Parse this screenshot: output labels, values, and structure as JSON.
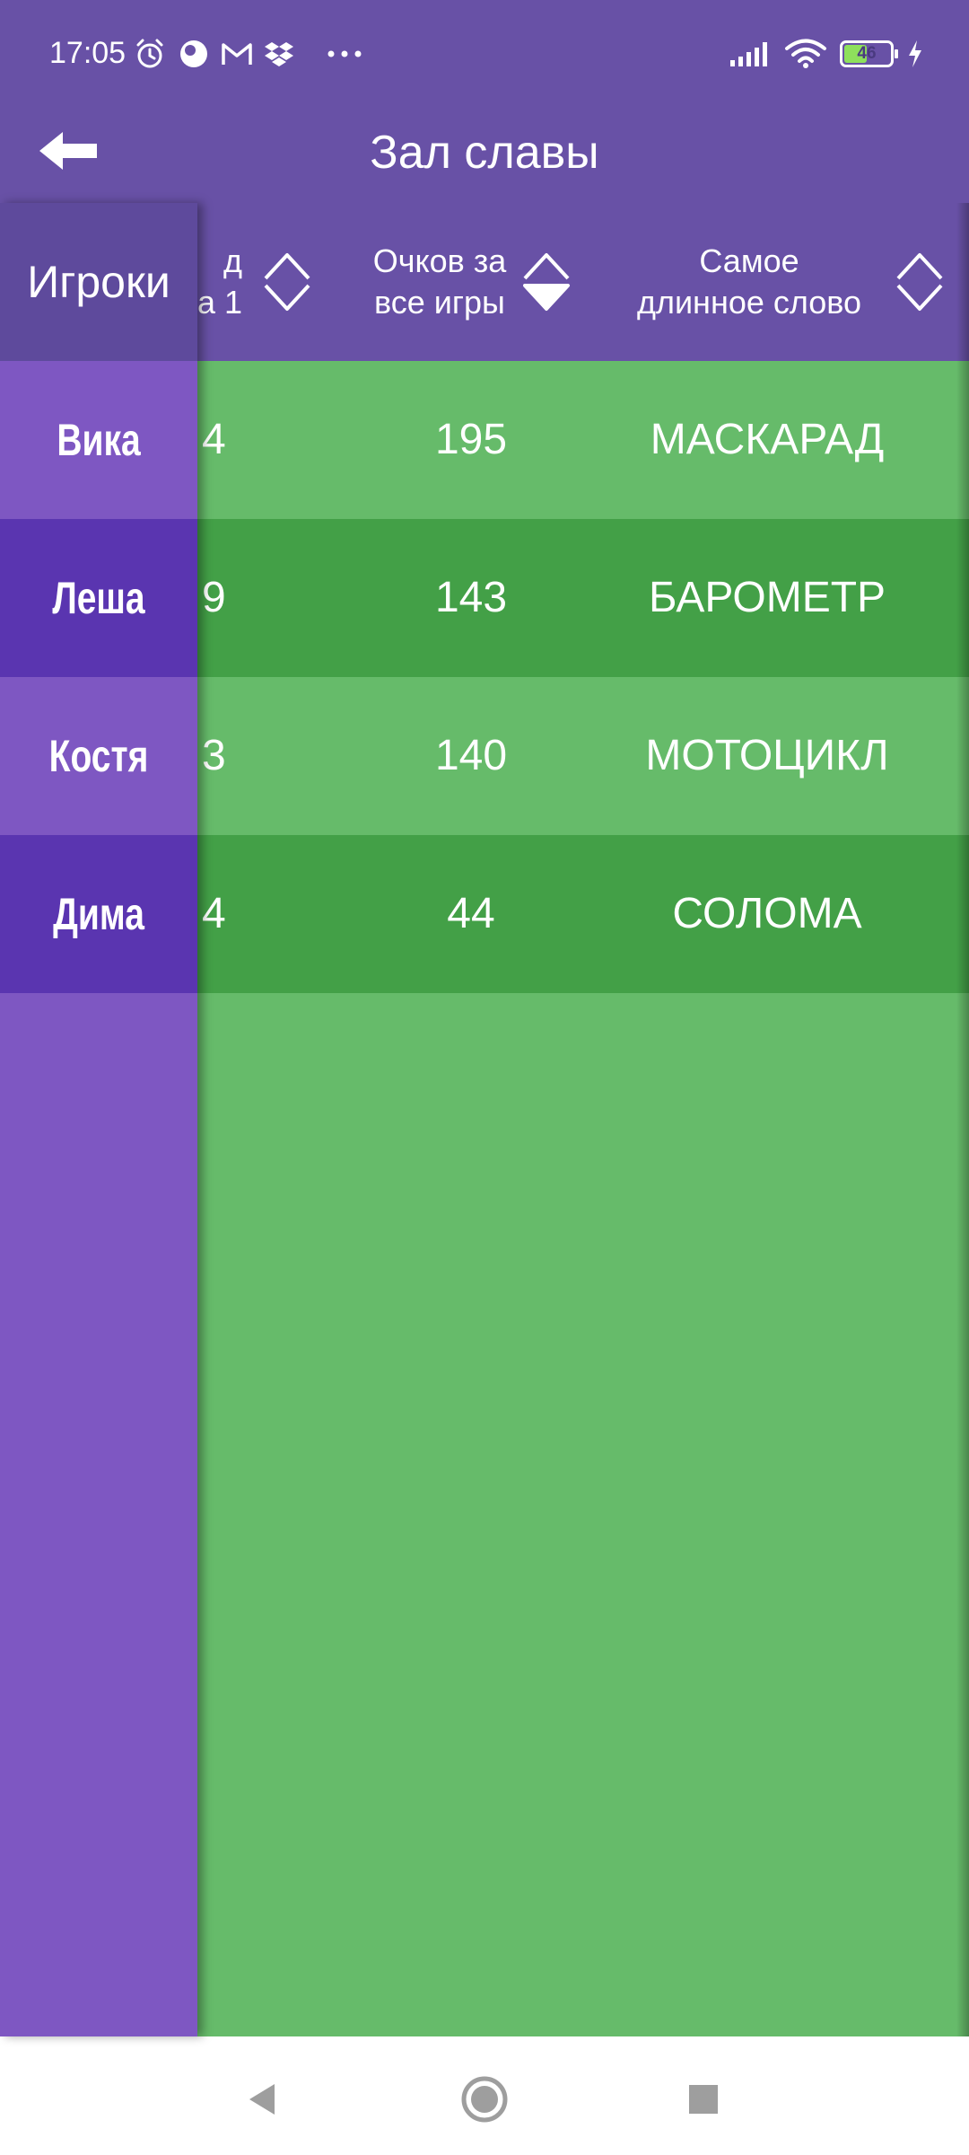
{
  "status_bar": {
    "time": "17:05",
    "battery_level": "46",
    "left_icons": [
      "alarm-icon",
      "app-icon",
      "gmail-icon",
      "dropbox-icon",
      "more-dots-icon"
    ],
    "right_icons": [
      "signal-icon",
      "wifi-icon",
      "battery-icon",
      "charging-icon"
    ]
  },
  "toolbar": {
    "title": "Зал славы",
    "back_icon": "back-arrow-icon"
  },
  "table": {
    "players_header": "Игроки",
    "columns": [
      {
        "label_line1": "д",
        "label_line2": "а 1"
      },
      {
        "label_line1": "Очков за",
        "label_line2": "все игры"
      },
      {
        "label_line1": "Самое",
        "label_line2": "длинное слово"
      }
    ],
    "rows": [
      {
        "player": "Вика",
        "col1": "4",
        "points": "195",
        "longest_word": "МАСКАРАД"
      },
      {
        "player": "Леша",
        "col1": "9",
        "points": "143",
        "longest_word": "БАРОМЕТР"
      },
      {
        "player": "Костя",
        "col1": "3",
        "points": "140",
        "longest_word": "МОТОЦИКЛ"
      },
      {
        "player": "Дима",
        "col1": "4",
        "points": "44",
        "longest_word": "СОЛОМА"
      }
    ]
  },
  "nav_bar": {
    "buttons": [
      "back-triangle-icon",
      "home-circle-icon",
      "recents-square-icon"
    ]
  },
  "colors": {
    "header": "#6851a6",
    "players_column": "#7e57c2",
    "players_row_dark": "#5a35b0",
    "table_light": "#66bb6a",
    "table_dark": "#43a047"
  }
}
